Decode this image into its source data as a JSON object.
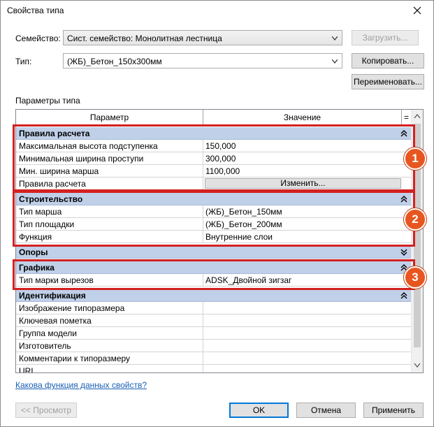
{
  "window": {
    "title": "Свойства типа"
  },
  "family": {
    "label": "Семейство:",
    "value": "Сист. семейство: Монолитная лестница",
    "load_button": "Загрузить..."
  },
  "type": {
    "label": "Тип:",
    "value": "(ЖБ)_Бетон_150х300мм",
    "copy_button": "Копировать...",
    "rename_button": "Переименовать..."
  },
  "params": {
    "section_label": "Параметры типа",
    "col_param": "Параметр",
    "col_value": "Значение",
    "col_eq": "=",
    "groups": [
      {
        "name": "Правила расчета",
        "rows": [
          {
            "param": "Максимальная высота подступенка",
            "value": "150,000"
          },
          {
            "param": "Минимальная ширина проступи",
            "value": "300,000"
          },
          {
            "param": "Мин. ширина марша",
            "value": "1100,000"
          },
          {
            "param": "Правила расчета",
            "value": "Изменить..."
          }
        ]
      },
      {
        "name": "Строительство",
        "rows": [
          {
            "param": "Тип марша",
            "value": "(ЖБ)_Бетон_150мм"
          },
          {
            "param": "Тип площадки",
            "value": "(ЖБ)_Бетон_200мм"
          },
          {
            "param": "Функция",
            "value": "Внутренние слои"
          }
        ]
      },
      {
        "name": "Опоры",
        "rows": []
      },
      {
        "name": "Графика",
        "rows": [
          {
            "param": "Тип марки вырезов",
            "value": "ADSK_Двойной зигзаг"
          }
        ]
      },
      {
        "name": "Идентификация",
        "rows": [
          {
            "param": "Изображение типоразмера",
            "value": ""
          },
          {
            "param": "Ключевая пометка",
            "value": ""
          },
          {
            "param": "Группа модели",
            "value": ""
          },
          {
            "param": "Изготовитель",
            "value": ""
          },
          {
            "param": "Комментарии к типоразмеру",
            "value": ""
          },
          {
            "param": "URL",
            "value": ""
          }
        ]
      }
    ]
  },
  "annotations": {
    "badge1": "1",
    "badge2": "2",
    "badge3": "3",
    "color": "#d42020",
    "badge_color": "#e8561f"
  },
  "help_link": "Какова функция данных свойств?",
  "footer": {
    "preview": "<< Просмотр",
    "ok": "OK",
    "cancel": "Отмена",
    "apply": "Применить"
  }
}
